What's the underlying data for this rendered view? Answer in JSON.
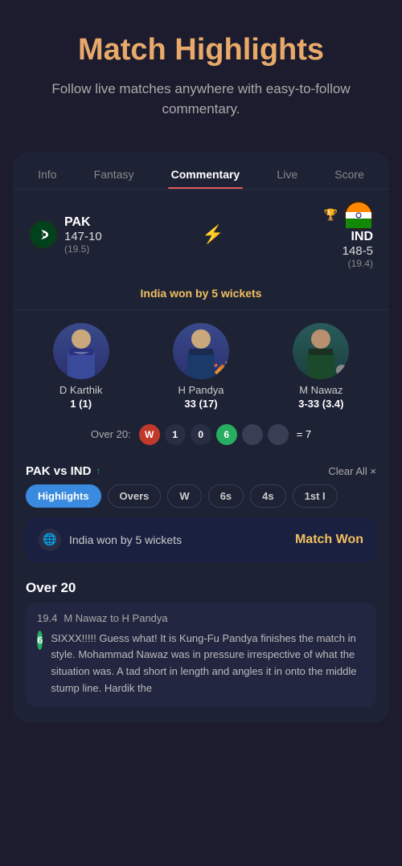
{
  "header": {
    "title": "Match Highlights",
    "subtitle": "Follow live matches anywhere with easy-to-follow commentary."
  },
  "tabs": [
    {
      "label": "Info",
      "active": false
    },
    {
      "label": "Fantasy",
      "active": false
    },
    {
      "label": "Commentary",
      "active": true
    },
    {
      "label": "Live",
      "active": false
    },
    {
      "label": "Score",
      "active": false
    }
  ],
  "match": {
    "team1": {
      "name": "PAK",
      "score": "147-10",
      "overs": "(19.5)",
      "flag": "🇵🇰"
    },
    "team2": {
      "name": "IND",
      "score": "148-5",
      "overs": "(19.4)",
      "flag": "🇮🇳",
      "winner": true,
      "trophy": "🏆"
    },
    "result": "India won by 5 wickets"
  },
  "players": [
    {
      "name": "D Karthik",
      "stat": "1 (1)",
      "emoji": "🧑"
    },
    {
      "name": "H Pandya",
      "stat": "33 (17)",
      "emoji": "🧑",
      "bat_emoji": "🏏"
    },
    {
      "name": "M Nawaz",
      "stat": "3-33 (3.4)",
      "emoji": "🧑"
    }
  ],
  "over": {
    "label": "Over 20:",
    "balls": [
      "W",
      "1",
      "0",
      "6",
      "",
      ""
    ],
    "total": "= 7"
  },
  "commentary_header": {
    "match_label": "PAK vs IND",
    "arrow": "↑",
    "clear_all": "Clear All ×"
  },
  "filter_pills": [
    {
      "label": "Highlights",
      "active": true
    },
    {
      "label": "Overs",
      "active": false
    },
    {
      "label": "W",
      "active": false
    },
    {
      "label": "6s",
      "active": false
    },
    {
      "label": "4s",
      "active": false
    },
    {
      "label": "1st I",
      "active": false
    }
  ],
  "match_won_banner": {
    "icon": "🌐",
    "text": "India won by 5 wickets",
    "badge": "Match Won"
  },
  "over_heading": "Over 20",
  "commentary": {
    "over_ball": "19.4",
    "bowler": "M Nawaz to H Pandya",
    "ball_value": "6",
    "text": "SIXXX!!!!! Guess what! It is Kung-Fu Pandya finishes the match in style. Mohammad Nawaz was in pressure irrespective of what the situation was. A tad short in length and angles it in onto the middle stump line. Hardik the"
  }
}
